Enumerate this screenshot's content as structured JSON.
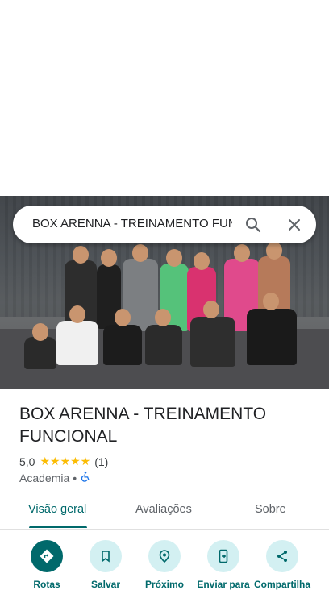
{
  "search": {
    "query": "BOX ARENNA - TREINAMENTO FUNCIONAL"
  },
  "place": {
    "name": "BOX ARENNA - TREINAMENTO FUNCIONAL",
    "rating": "5,0",
    "stars": "★★★★★",
    "review_count": "(1)",
    "category": "Academia",
    "separator": "•"
  },
  "tabs": [
    {
      "label": "Visão geral",
      "active": true
    },
    {
      "label": "Avaliações",
      "active": false
    },
    {
      "label": "Sobre",
      "active": false
    }
  ],
  "actions": [
    {
      "label": "Rotas",
      "icon": "directions-icon"
    },
    {
      "label": "Salvar",
      "icon": "bookmark-icon"
    },
    {
      "label": "Próximo",
      "icon": "nearby-icon"
    },
    {
      "label": "Enviar para",
      "icon": "send-to-phone-icon"
    },
    {
      "label": "Compartilha",
      "icon": "share-icon"
    }
  ],
  "colors": {
    "accent": "#00696b",
    "accent_light": "#d3f0f2",
    "star": "#fbbc04"
  }
}
